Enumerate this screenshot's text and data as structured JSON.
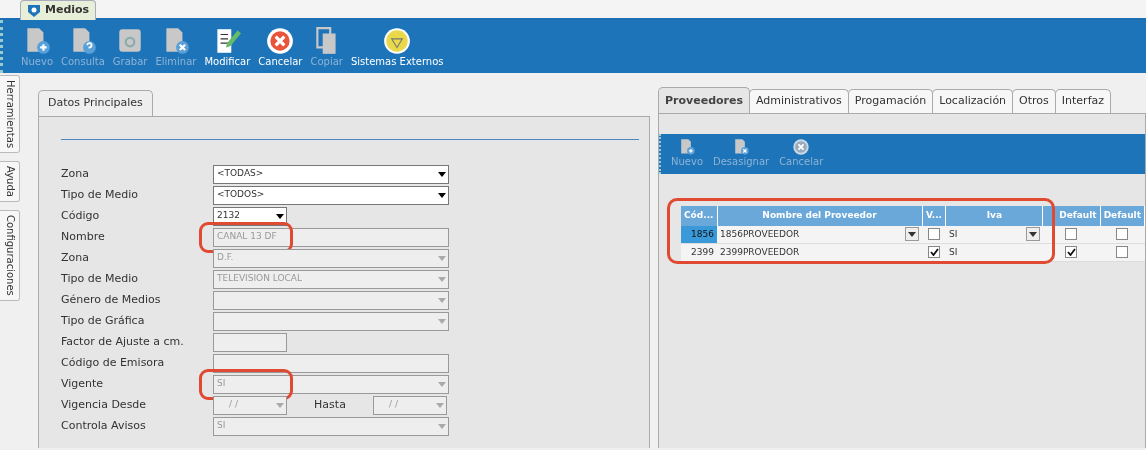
{
  "window": {
    "tab": "Medios"
  },
  "toolbar": [
    {
      "label": "Nuevo",
      "kind": "doc-plus",
      "disabled": true
    },
    {
      "label": "Consulta",
      "kind": "doc-question",
      "disabled": true
    },
    {
      "label": "Grabar",
      "kind": "disk",
      "disabled": true
    },
    {
      "label": "Eliminar",
      "kind": "doc-x",
      "disabled": true
    },
    {
      "label": "Modificar",
      "kind": "pencil",
      "disabled": false
    },
    {
      "label": "Cancelar",
      "kind": "cancel",
      "disabled": false
    },
    {
      "label": "Copiar",
      "kind": "copy",
      "disabled": true
    },
    {
      "label": "Sistemas Externos",
      "kind": "external",
      "disabled": false
    }
  ],
  "side_tabs": [
    "Herramientas",
    "Ayuda",
    "Configuraciones"
  ],
  "left_panel": {
    "tab": "Datos Principales",
    "fields": [
      {
        "label": "Zona",
        "kind": "combo",
        "value": "<TODAS>",
        "disabled": false
      },
      {
        "label": "Tipo de Medio",
        "kind": "combo",
        "value": "<TODOS>",
        "disabled": false
      },
      {
        "label": "Código",
        "kind": "short-combo",
        "value": "2132",
        "disabled": false
      },
      {
        "label": "Nombre",
        "kind": "text",
        "value": "CANAL 13 DF",
        "disabled": true,
        "highlighted": true
      },
      {
        "label": "Zona",
        "kind": "combo",
        "value": "D.F.",
        "disabled": true
      },
      {
        "label": "Tipo de Medio",
        "kind": "combo",
        "value": "TELEVISION LOCAL",
        "disabled": true
      },
      {
        "label": "Género de Medios",
        "kind": "combo",
        "disabled": true
      },
      {
        "label": "Tipo de Gráfica",
        "kind": "combo",
        "disabled": true
      },
      {
        "label": "Factor de Ajuste a cm.",
        "kind": "short-text",
        "disabled": true
      },
      {
        "label": "Código de Emisora",
        "kind": "text",
        "disabled": true
      },
      {
        "label": "Vigente",
        "kind": "combo",
        "value": "SI",
        "disabled": true,
        "highlighted": true
      },
      {
        "label": "Vigencia Desde",
        "kind": "date-range",
        "value": "/ /",
        "to_label": "Hasta",
        "to_value": "/ /",
        "disabled": true
      },
      {
        "label": "Controla Avisos",
        "kind": "combo",
        "value": "SI",
        "disabled": true
      }
    ]
  },
  "right_panel": {
    "tabs": [
      {
        "label": "Proveedores",
        "selected": true
      },
      {
        "label": "Administrativos",
        "selected": false
      },
      {
        "label": "Progamación",
        "selected": false
      },
      {
        "label": "Localización",
        "selected": false
      },
      {
        "label": "Otros",
        "selected": false
      },
      {
        "label": "Interfaz",
        "selected": false
      }
    ],
    "toolbar": [
      {
        "label": "Nuevo",
        "kind": "doc-plus",
        "disabled": true
      },
      {
        "label": "Desasignar",
        "kind": "doc-x",
        "disabled": true
      },
      {
        "label": "Cancelar",
        "kind": "cancel",
        "disabled": true
      }
    ],
    "grid": {
      "highlighted": true,
      "columns": [
        "Cód...",
        "Nombre del Proveedor",
        "V...",
        "Iva",
        "Default",
        "Default"
      ],
      "rows": [
        {
          "selected": true,
          "code": "1856",
          "name": "1856PROVEEDOR",
          "vigente": false,
          "iva": "SI",
          "default_1": false,
          "default_2": false
        },
        {
          "selected": false,
          "code": "2399",
          "name": "2399PROVEEDOR",
          "vigente": true,
          "iva": "SI",
          "default_1": true,
          "default_2": false
        }
      ]
    }
  }
}
